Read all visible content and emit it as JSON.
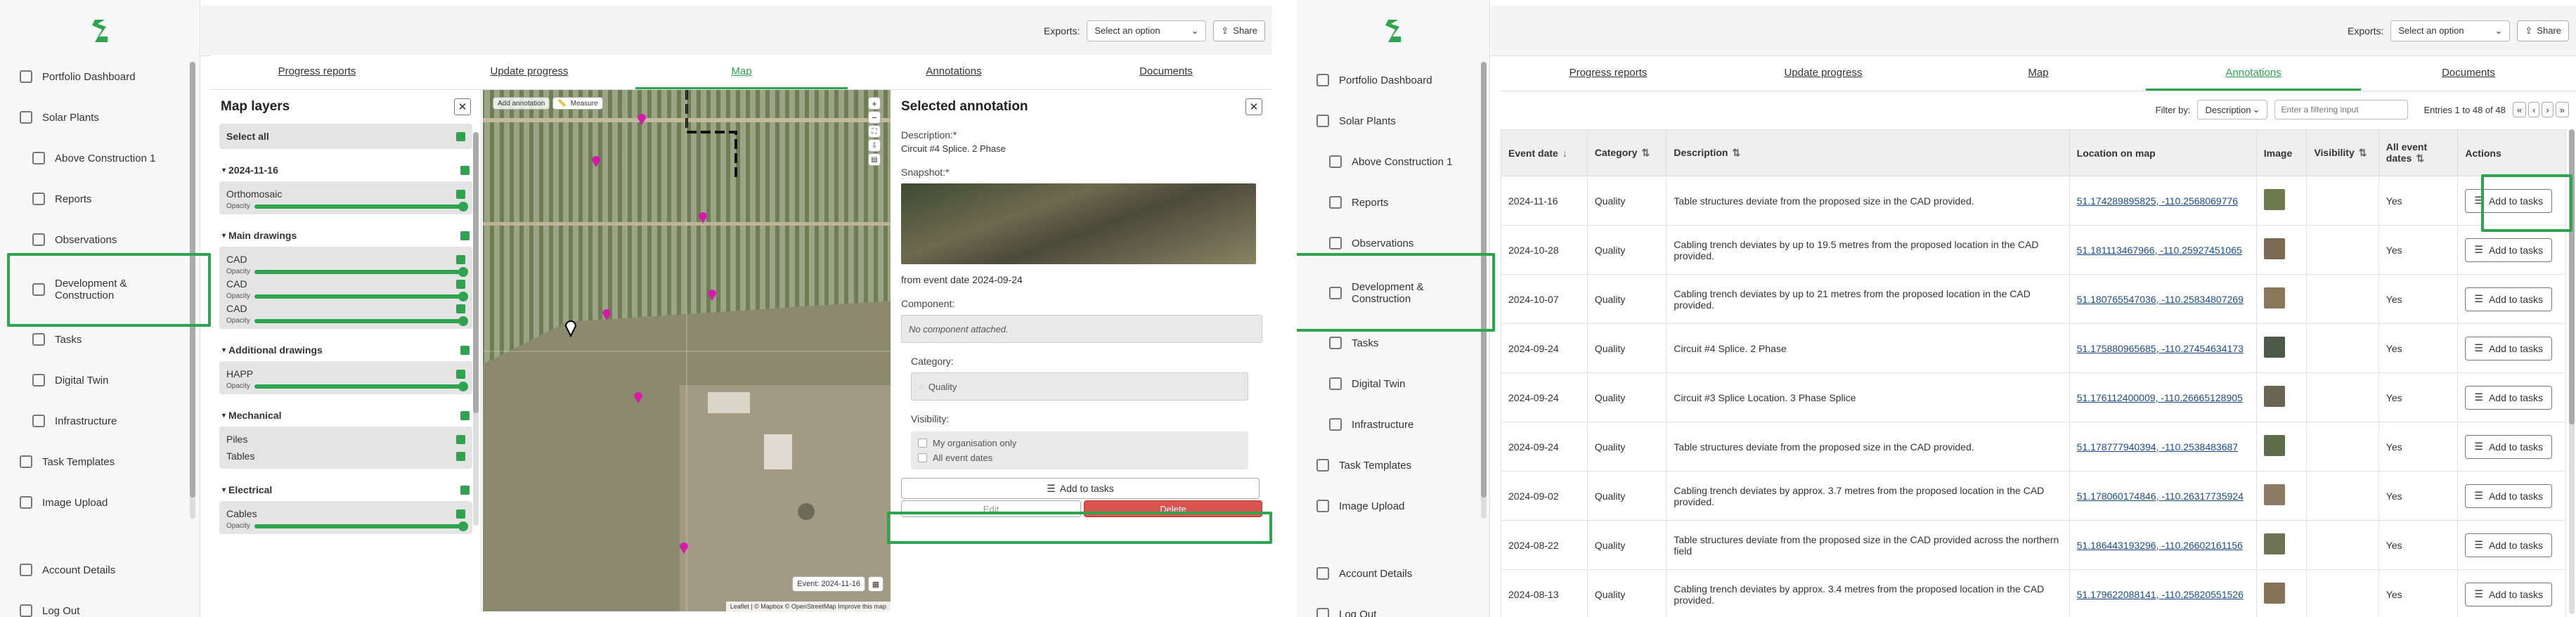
{
  "left": {
    "sidebar": {
      "items": [
        {
          "label": "Portfolio Dashboard",
          "icon": "dashboard-icon"
        },
        {
          "label": "Solar Plants",
          "icon": "home-icon"
        },
        {
          "label": "Above Construction 1",
          "icon": "plant-icon"
        },
        {
          "label": "Reports",
          "icon": "report-icon"
        },
        {
          "label": "Observations",
          "icon": "observation-icon"
        },
        {
          "label": "Development & Construction",
          "icon": "construction-icon"
        },
        {
          "label": "Tasks",
          "icon": "tasks-icon"
        },
        {
          "label": "Digital Twin",
          "icon": "globe-icon"
        },
        {
          "label": "Infrastructure",
          "icon": "infrastructure-icon"
        },
        {
          "label": "Task Templates",
          "icon": "template-icon"
        },
        {
          "label": "Image Upload",
          "icon": "upload-icon"
        },
        {
          "label": "Account Details",
          "icon": "account-icon"
        },
        {
          "label": "Log Out",
          "icon": "logout-icon"
        }
      ]
    },
    "topbar": {
      "exports_label": "Exports:",
      "exports_select": "Select an option",
      "share_label": "Share"
    },
    "tabs": [
      "Progress reports",
      "Update progress",
      "Map",
      "Annotations",
      "Documents"
    ],
    "map_layers": {
      "title": "Map layers",
      "select_all": "Select all",
      "groups": [
        {
          "name": "2024-11-16",
          "items": [
            "Orthomosaic"
          ]
        },
        {
          "name": "Main drawings",
          "items": [
            "CAD",
            "CAD",
            "CAD"
          ]
        },
        {
          "name": "Additional drawings",
          "items": [
            "HAPP"
          ]
        },
        {
          "name": "Mechanical",
          "items": [
            "Piles",
            "Tables"
          ]
        },
        {
          "name": "Electrical",
          "items": [
            "Cables"
          ]
        }
      ],
      "opacity_label": "Opacity"
    },
    "map": {
      "add_annotation": "Add annotation",
      "measure": "Measure",
      "event_badge": "Event: 2024-11-16",
      "attribution": "Leaflet | © Mapbox © OpenStreetMap Improve this map"
    },
    "annotation": {
      "title": "Selected annotation",
      "description_label": "Description:*",
      "description": "Circuit #4 Splice. 2 Phase",
      "snapshot_label": "Snapshot:*",
      "from_event": "from event date 2024-09-24",
      "component_label": "Component:",
      "component_value": "No component attached.",
      "category_label": "Category:",
      "category_value": "Quality",
      "visibility_label": "Visibility:",
      "visibility_org": "My organisation only",
      "visibility_all": "All event dates",
      "add_to_tasks": "Add to tasks",
      "edit": "Edit",
      "delete": "Delete"
    }
  },
  "right": {
    "sidebar": {
      "items": [
        {
          "label": "Portfolio Dashboard"
        },
        {
          "label": "Solar Plants"
        },
        {
          "label": "Above Construction 1"
        },
        {
          "label": "Reports"
        },
        {
          "label": "Observations"
        },
        {
          "label": "Development & Construction"
        },
        {
          "label": "Tasks"
        },
        {
          "label": "Digital Twin"
        },
        {
          "label": "Infrastructure"
        },
        {
          "label": "Task Templates"
        },
        {
          "label": "Image Upload"
        },
        {
          "label": "Account Details"
        },
        {
          "label": "Log Out"
        }
      ]
    },
    "topbar": {
      "exports_label": "Exports:",
      "exports_select": "Select an option",
      "share_label": "Share"
    },
    "tabs": [
      "Progress reports",
      "Update progress",
      "Map",
      "Annotations",
      "Documents"
    ],
    "filter": {
      "label": "Filter by:",
      "select": "Description",
      "placeholder": "Enter a filtering input",
      "entries": "Entries 1 to 48 of 48"
    },
    "pager": [
      "«",
      "‹",
      "›",
      "»"
    ],
    "columns": [
      "Event date",
      "Category",
      "Description",
      "Location on map",
      "Image",
      "Visibility",
      "All event dates",
      "Actions"
    ],
    "rows": [
      {
        "date": "2024-11-16",
        "cat": "Quality",
        "desc": "Table structures deviate from the proposed size in the CAD provided.",
        "loc": "51.174289895825, -110.2568069776",
        "all": "Yes",
        "color": "#6d7a4e"
      },
      {
        "date": "2024-10-28",
        "cat": "Quality",
        "desc": "Cabling trench deviates by up to 19.5 metres from the proposed location in the CAD provided.",
        "loc": "51.181113467966, -110.25927451065",
        "all": "Yes",
        "color": "#7a6a52"
      },
      {
        "date": "2024-10-07",
        "cat": "Quality",
        "desc": "Cabling trench deviates by up to 21 metres from the proposed location in the CAD provided.",
        "loc": "51.180765547036, -110.25834807269",
        "all": "Yes",
        "color": "#8a7658"
      },
      {
        "date": "2024-09-24",
        "cat": "Quality",
        "desc": "Circuit #4 Splice. 2 Phase",
        "loc": "51.175880965685, -110.27454634173",
        "all": "Yes",
        "color": "#4e5a48"
      },
      {
        "date": "2024-09-24",
        "cat": "Quality",
        "desc": "Circuit #3 Splice Location. 3 Phase Splice",
        "loc": "51.176112400009, -110.26665128905",
        "all": "Yes",
        "color": "#6a6452"
      },
      {
        "date": "2024-09-24",
        "cat": "Quality",
        "desc": "Table structures deviate from the proposed size in the CAD provided.",
        "loc": "51.178777940394, -110.2538483687",
        "all": "Yes",
        "color": "#5d6e4a"
      },
      {
        "date": "2024-09-02",
        "cat": "Quality",
        "desc": "Cabling trench deviates by approx. 3.7 metres from the proposed location in the CAD provided.",
        "loc": "51.178060174846, -110.26317735924",
        "all": "Yes",
        "color": "#8c7a62"
      },
      {
        "date": "2024-08-22",
        "cat": "Quality",
        "desc": "Table structures deviate from the proposed size in the CAD provided across the northern field",
        "loc": "51.186443193296, -110.26602161156",
        "all": "Yes",
        "color": "#6e7356"
      },
      {
        "date": "2024-08-13",
        "cat": "Quality",
        "desc": "Cabling trench deviates by approx. 3.4 metres from the proposed location in the CAD provided.",
        "loc": "51.179622088141, -110.25820551526",
        "all": "Yes",
        "color": "#857258"
      }
    ],
    "add_to_tasks": "Add to tasks"
  }
}
